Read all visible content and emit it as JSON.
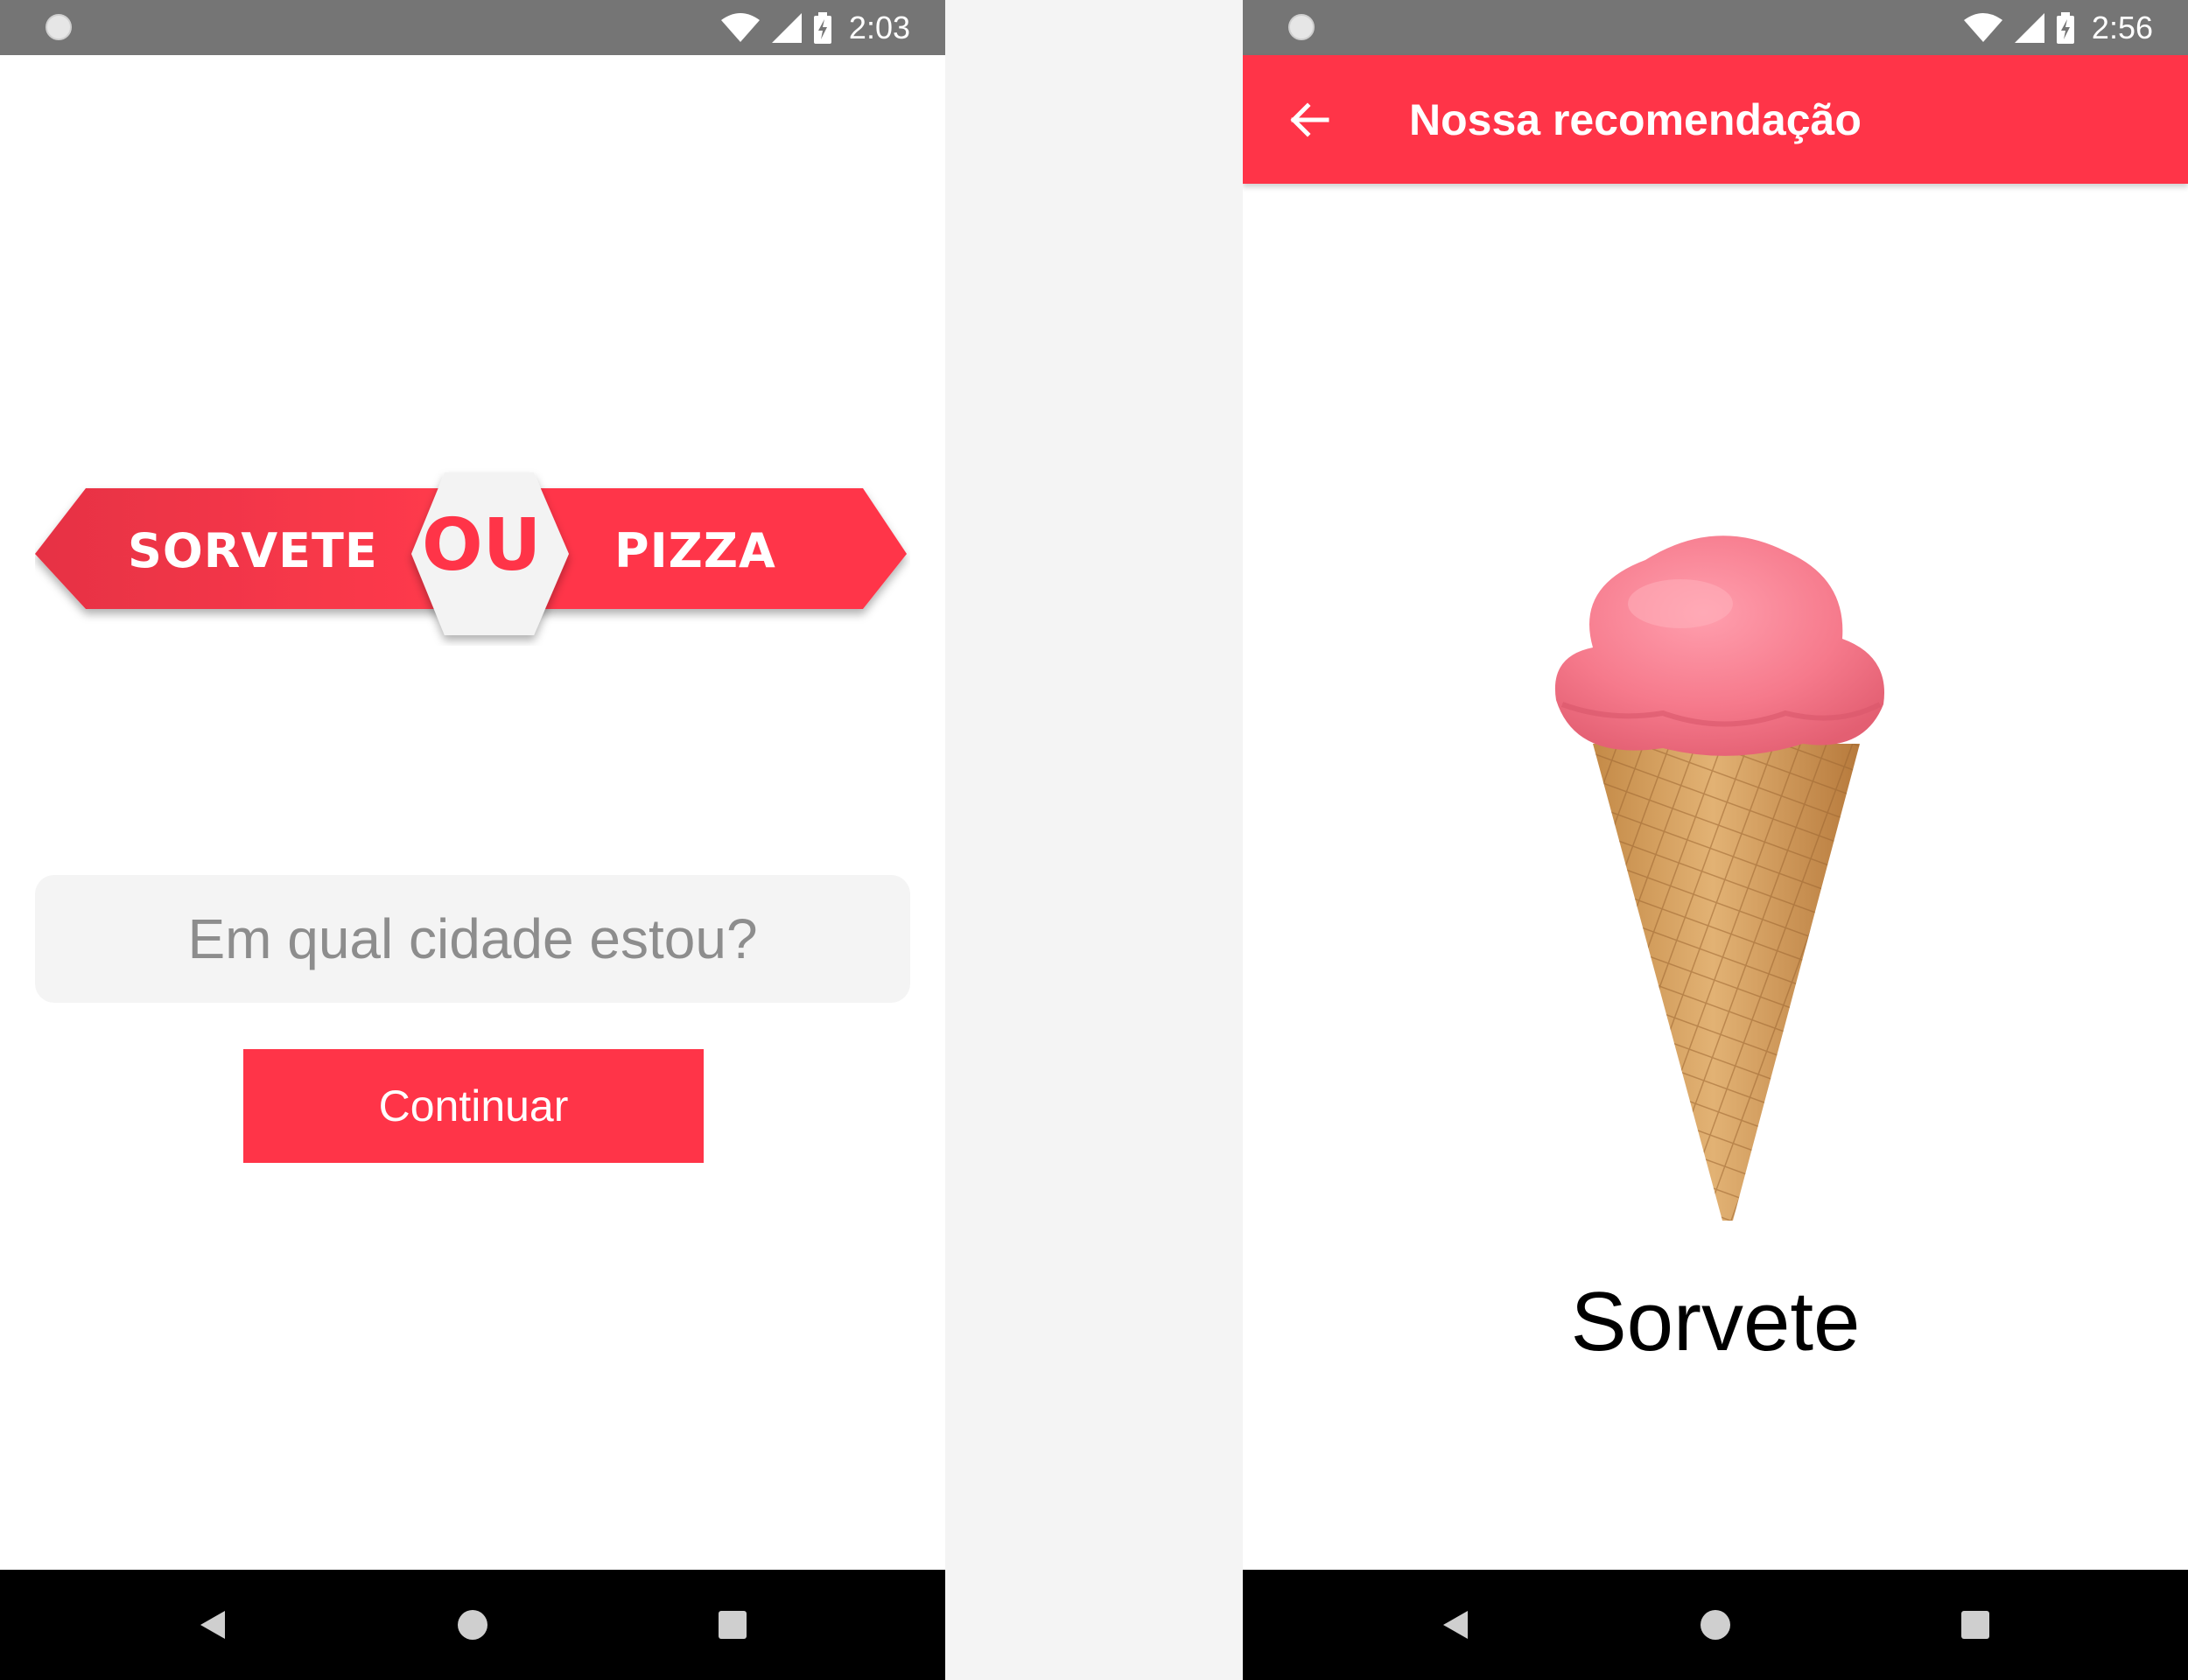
{
  "colors": {
    "accent": "#ff3448",
    "status_bar": "#757575",
    "input_bg": "#f4f4f4"
  },
  "left_screen": {
    "status_bar": {
      "time": "2:03"
    },
    "banner": {
      "left_label": "SORVETE",
      "middle_label": "OU",
      "right_label": "PIZZA"
    },
    "city_input": {
      "placeholder": "Em qual cidade estou?",
      "value": ""
    },
    "continue_button": {
      "label": "Continuar"
    }
  },
  "right_screen": {
    "status_bar": {
      "time": "2:56"
    },
    "app_bar": {
      "title": "Nossa recomendação",
      "back_icon": "arrow-left-icon"
    },
    "result": {
      "image": "ice-cream-cone",
      "label": "Sorvete"
    }
  }
}
